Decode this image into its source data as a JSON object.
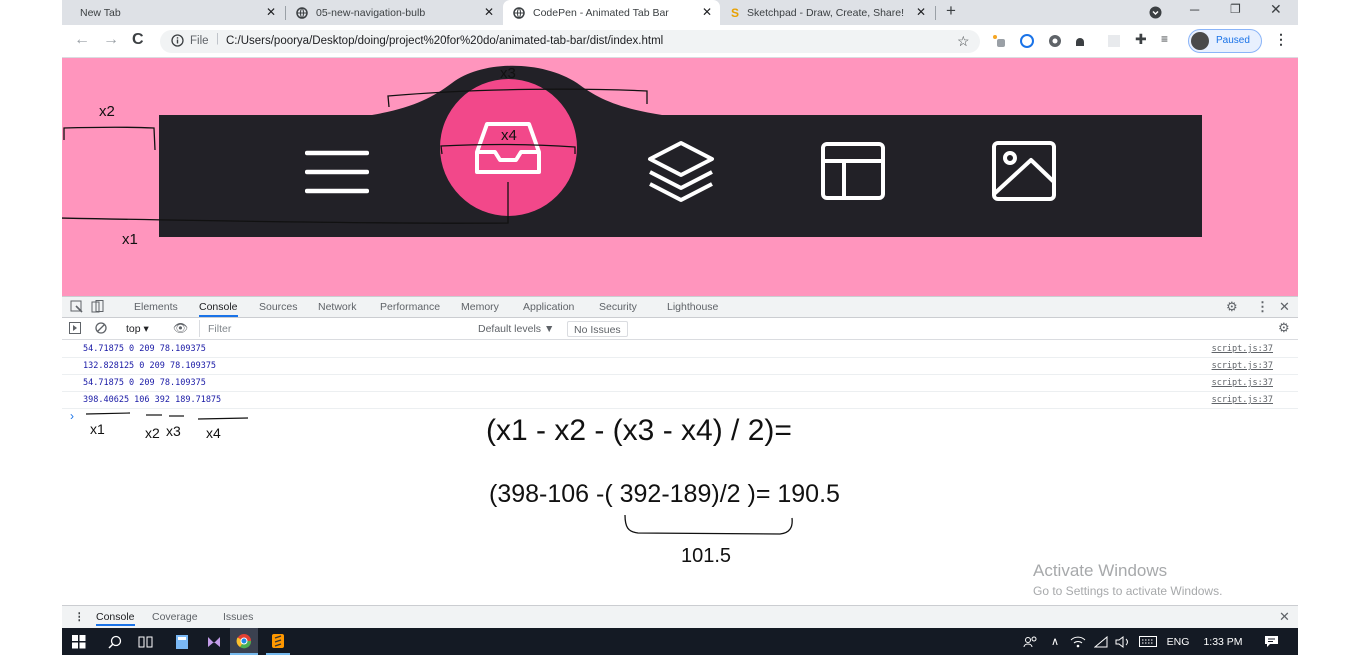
{
  "browser": {
    "tabs": [
      {
        "title": "New Tab",
        "active": false
      },
      {
        "title": "05-new-navigation-bulb",
        "active": false
      },
      {
        "title": "CodePen - Animated Tab Bar",
        "active": true
      },
      {
        "title": "Sketchpad - Draw, Create, Share!",
        "active": false
      }
    ],
    "new_tab_label": "+",
    "address": {
      "scheme_label": "File",
      "url": "C:/Users/poorya/Desktop/doing/project%20for%20do/animated-tab-bar/dist/index.html"
    },
    "profile_status": "Paused"
  },
  "page": {
    "background": "#ff95bd",
    "bar_color": "#222127",
    "bulb_color": "#f2488a",
    "tab_icons": [
      "menu-icon",
      "inbox-icon",
      "layers-icon",
      "layout-icon",
      "image-icon"
    ],
    "active_index": 1,
    "annotations": {
      "x1": "x1",
      "x2": "x2",
      "x3": "x3",
      "x4": "x4"
    }
  },
  "devtools": {
    "tabs": [
      "Elements",
      "Console",
      "Sources",
      "Network",
      "Performance",
      "Memory",
      "Application",
      "Security",
      "Lighthouse"
    ],
    "active_tab": "Console",
    "context": "top",
    "filter_placeholder": "Filter",
    "levels": "Default levels ▼",
    "issues": "No Issues",
    "logs": [
      {
        "text": "54.71875 0 209 78.109375",
        "source": "script.js:37"
      },
      {
        "text": "132.828125 0 209 78.109375",
        "source": "script.js:37"
      },
      {
        "text": "54.71875 0 209 78.109375",
        "source": "script.js:37"
      },
      {
        "text": "398.40625 106 392 189.71875",
        "source": "script.js:37"
      }
    ],
    "prompt": "›",
    "labels": [
      "x1",
      "x2",
      "x3",
      "x4"
    ],
    "formula": "(x1 - x2 - (x3  - x4) / 2)=",
    "calculation_left": "(398-106 -(",
    "calculation_mid": " 392-189)/2 )",
    "calculation_right": "= 190.5",
    "brace_value": "101.5",
    "drawer_tabs": [
      "Console",
      "Coverage",
      "Issues"
    ],
    "watermark_title": "Activate Windows",
    "watermark_sub": "Go to Settings to activate Windows."
  },
  "taskbar": {
    "language": "ENG",
    "time": "1:33 PM"
  }
}
